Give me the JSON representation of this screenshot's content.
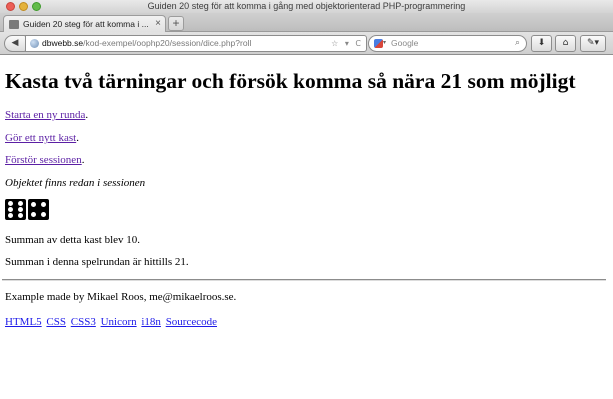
{
  "window": {
    "title": "Guiden 20 steg för att komma i gång med objektorienterad PHP-programmering"
  },
  "tabs": [
    {
      "label": "Guiden 20 steg för att komma i ...",
      "close": "×"
    }
  ],
  "new_tab_label": "+",
  "navbar": {
    "back_icon": "◀",
    "url_domain": "dbwebb.se",
    "url_path": "/kod-exempel/oophp20/session/dice.php?roll",
    "url_icons": "☆ ▾ C",
    "search_placeholder": "Google",
    "search_caret": "▾",
    "search_icon": "⌕",
    "download_icon": "⬇",
    "home_icon": "⌂",
    "addon_icon": "✎▾"
  },
  "page": {
    "heading": "Kasta två tärningar och försök komma så nära 21 som möjligt",
    "links": [
      {
        "label": "Starta en ny runda",
        "suffix": "."
      },
      {
        "label": "Gör ett nytt kast",
        "suffix": "."
      },
      {
        "label": "Förstör sessionen",
        "suffix": "."
      }
    ],
    "session_note": "Objektet finns redan i sessionen",
    "dice_values": [
      6,
      4
    ],
    "roll_sum": "Summan av detta kast blev 10.",
    "round_sum": "Summan i denna spelrundan är hittills 21.",
    "footer_text": "Example made by Mikael Roos, me@mikaelroos.se.",
    "footer_links": [
      "HTML5",
      "CSS",
      "CSS3",
      "Unicorn",
      "i18n",
      "Sourcecode"
    ]
  },
  "colors": {
    "visited_link": "#5b1fa4",
    "link": "#1d1ae8"
  }
}
